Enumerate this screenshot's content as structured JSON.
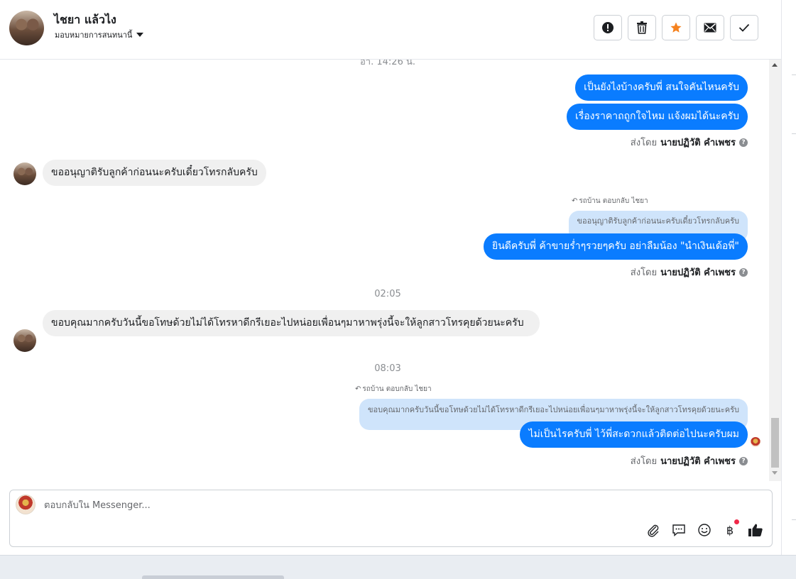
{
  "header": {
    "name": "ไชยา แล้วไง",
    "assign": "มอบหมายการสนทนานี้"
  },
  "actions": [
    {
      "name": "spam-button",
      "icon": "alert-icon"
    },
    {
      "name": "delete-button",
      "icon": "trash-icon"
    },
    {
      "name": "star-button",
      "icon": "star-icon"
    },
    {
      "name": "mark-unread-button",
      "icon": "envelope-icon"
    },
    {
      "name": "done-button",
      "icon": "check-icon"
    }
  ],
  "conversation": {
    "top_timestamp": "อา. 14:26 น.",
    "msg1": "เป็นยังไงบ้างครับพี่ สนใจคันไหนครับ",
    "msg2": "เรื่องราคาถถูกใจไหม แจ้งผมได้นะครับ",
    "sent_by_label": "ส่งโดย",
    "sender": "นายปฏิวัติ คำเพชร",
    "msg3": "ขออนุญาติรับลูกค้าก่อนนะครับเดี๋ยวโทรกลับครับ",
    "reply_label_1": "รถบ้าน ตอบกลับ ไชยา",
    "quote1": "ขออนุญาติรับลูกค้าก่อนนะครับเดี๋ยวโทรกลับครับ",
    "msg4": "ยินดีครับพี่ ค้าขายร่ำๆรวยๆครับ อย่าลืมน้อง \"นำเงินเด้อพี่\"",
    "time2": "02:05",
    "msg5": "ขอบคุณมากครับวันนี้ขอโทษด้วยไม่ได้โทรหาดีกรีเยอะไปหน่อยเพื่อนๆมาหาพรุ่งนี้จะให้ลูกสาวโทรคุยด้วยนะครับ",
    "time3": "08:03",
    "reply_label_2": "รถบ้าน ตอบกลับ ไชยา",
    "quote2": "ขอบคุณมากครับวันนี้ขอโทษด้วยไม่ได้โทรหาดีกรีเยอะไปหน่อยเพื่อนๆมาหาพรุ่งนี้จะให้ลูกสาวโทรคุยด้วยนะครับ",
    "msg6": "ไม่เป็นไรครับพี่ ไว้พี่สะดวกแล้วติดต่อไปนะครับผม"
  },
  "composer": {
    "placeholder": "ตอบกลับใน Messenger...",
    "currency_symbol": "฿",
    "tools": [
      "attach-icon",
      "saved-replies-icon",
      "emoji-icon",
      "payment-icon",
      "thumbs-up-icon"
    ]
  },
  "colors": {
    "outgoing": "#0a7cff",
    "incoming": "#f0f0f0",
    "quote": "#cfe4fb",
    "star": "#f5821f"
  }
}
